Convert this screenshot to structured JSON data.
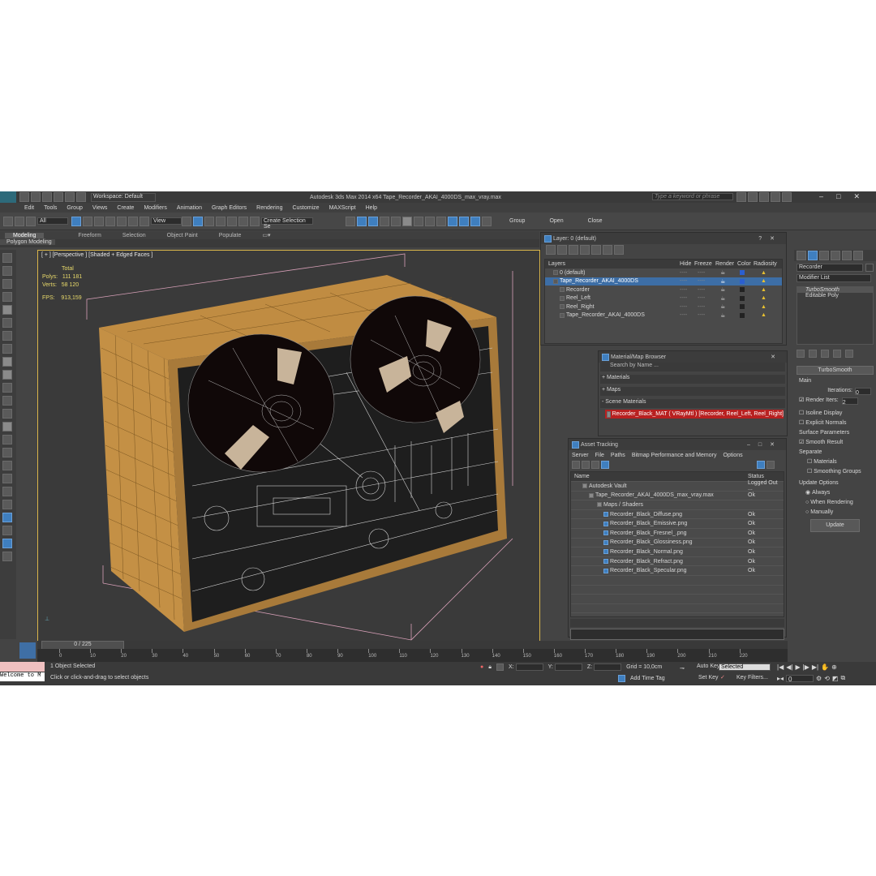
{
  "window": {
    "title": "Autodesk 3ds Max  2014 x64     Tape_Recorder_AKAI_4000DS_max_vray.max",
    "workspace": "Workspace: Default",
    "search_placeholder": "Type a keyword or phrase"
  },
  "menu": [
    "Edit",
    "Tools",
    "Group",
    "Views",
    "Create",
    "Modifiers",
    "Animation",
    "Graph Editors",
    "Rendering",
    "Customize",
    "MAXScript",
    "Help"
  ],
  "toolbar": {
    "filter_value": "All",
    "view_value": "View",
    "selection_set": "Create Selection Se",
    "group_labels": [
      "Group",
      "Open",
      "Close"
    ]
  },
  "ribbon": {
    "tabs": [
      "Modeling",
      "Freeform",
      "Selection",
      "Object Paint",
      "Populate"
    ],
    "sub": "Polygon Modeling"
  },
  "viewport": {
    "label": "[ + ] [Perspective ] [Shaded + Edged Faces ]",
    "stats": {
      "total_label": "Total",
      "polys_label": "Polys:",
      "polys": "111 181",
      "verts_label": "Verts:",
      "verts": "58 120",
      "fps_label": "FPS:",
      "fps": "913,159"
    }
  },
  "layer_dialog": {
    "title": "Layer: 0 (default)",
    "columns": [
      "Layers",
      "Hide",
      "Freeze",
      "Render",
      "Color",
      "Radiosity"
    ],
    "rows": [
      {
        "name": "0 (default)",
        "dash": "----"
      },
      {
        "name": "Tape_Recorder_AKAI_4000DS",
        "dash": "----"
      },
      {
        "name": "Recorder",
        "dash": "----"
      },
      {
        "name": "Reel_Left",
        "dash": "----"
      },
      {
        "name": "Reel_Right",
        "dash": "----"
      },
      {
        "name": "Tape_Recorder_AKAI_4000DS",
        "dash": "----"
      }
    ]
  },
  "material_browser": {
    "title": "Material/Map Browser",
    "search_placeholder": "Search by Name ...",
    "sections": [
      "+ Materials",
      "+ Maps",
      "- Scene Materials"
    ],
    "scene_material": "Recorder_Black_MAT  ( VRayMtl )  [Recorder, Reel_Left, Reel_Right]"
  },
  "asset_tracking": {
    "title": "Asset Tracking",
    "menu": [
      "Server",
      "File",
      "Paths",
      "Bitmap Performance and Memory",
      "Options"
    ],
    "columns": [
      "Name",
      "Status"
    ],
    "rows": [
      {
        "name": "Autodesk Vault",
        "status": "Logged Out ..."
      },
      {
        "name": "Tape_Recorder_AKAI_4000DS_max_vray.max",
        "status": "Ok"
      },
      {
        "name": "Maps / Shaders",
        "status": ""
      },
      {
        "name": "Recorder_Black_Diffuse.png",
        "status": "Ok"
      },
      {
        "name": "Recorder_Black_Emissive.png",
        "status": "Ok"
      },
      {
        "name": "Recorder_Black_Fresnel_.png",
        "status": "Ok"
      },
      {
        "name": "Recorder_Black_Glossiness.png",
        "status": "Ok"
      },
      {
        "name": "Recorder_Black_Normal.png",
        "status": "Ok"
      },
      {
        "name": "Recorder_Black_Refract.png",
        "status": "Ok"
      },
      {
        "name": "Recorder_Black_Specular.png",
        "status": "Ok"
      }
    ]
  },
  "command_panel": {
    "object_name": "Recorder",
    "modifier_list": "Modifier List",
    "stack": [
      "TurboSmooth",
      "Editable Poly"
    ],
    "rollout_title": "TurboSmooth",
    "main_label": "Main",
    "iterations_label": "Iterations:",
    "iterations": "0",
    "render_iters_label": "Render Iters:",
    "render_iters": "2",
    "isoline": "Isoline Display",
    "explicit_normals": "Explicit Normals",
    "surface_params": "Surface Parameters",
    "smooth_result": "Smooth Result",
    "separate": "Separate",
    "materials": "Materials",
    "smoothing_groups": "Smoothing Groups",
    "update_options": "Update Options",
    "always": "Always",
    "when_rendering": "When Rendering",
    "manually": "Manually",
    "update_button": "Update"
  },
  "timeline": {
    "frame": "0 / 225",
    "ticks": [
      "0",
      "10",
      "20",
      "30",
      "40",
      "50",
      "60",
      "70",
      "80",
      "90",
      "100",
      "110",
      "120",
      "130",
      "140",
      "150",
      "160",
      "170",
      "180",
      "190",
      "200",
      "210",
      "220"
    ]
  },
  "status": {
    "maxscript": "Welcome to M",
    "selected": "1 Object Selected",
    "prompt": "Click or click-and-drag to select objects",
    "x_label": "X:",
    "y_label": "Y:",
    "z_label": "Z:",
    "grid": "Grid = 10,0cm",
    "add_time_tag": "Add Time Tag",
    "auto_key": "Auto Key",
    "set_key": "Set Key",
    "key_selected": "Selected",
    "key_filters": "Key Filters...",
    "frame_field": "0"
  }
}
